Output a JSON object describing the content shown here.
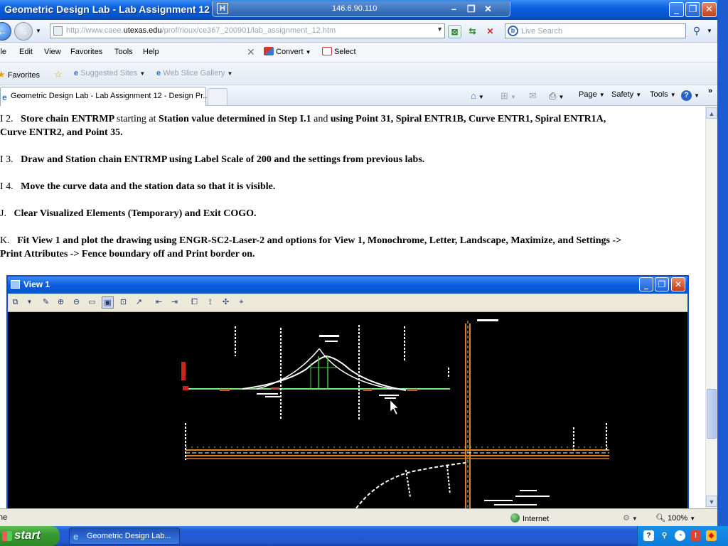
{
  "window": {
    "title": "Geometric Design Lab - Lab Assignment 12 - ",
    "remote_host": "146.6.90.110",
    "colors": {
      "xp_blue": "#0a5fdf",
      "close_red": "#c33f17",
      "cad_bg": "#000000"
    }
  },
  "address_bar": {
    "url_prefix": "http://www.caee.",
    "url_domain": "utexas.edu",
    "url_path": "/prof/rioux/ce367_200901/lab_assignment_12.htm",
    "search_placeholder": "Live Search"
  },
  "menu": {
    "items": [
      "ile",
      "Edit",
      "View",
      "Favorites",
      "Tools",
      "Help"
    ],
    "convert_label": "Convert",
    "select_label": "Select"
  },
  "favorites_bar": {
    "favorites_label": "Favorites",
    "suggested_sites": "Suggested Sites",
    "web_slice_gallery": "Web Slice Gallery"
  },
  "tabs": {
    "active_tab": "Geometric Design Lab - Lab Assignment 12 - Design Pr...",
    "commands": [
      "Page",
      "Safety",
      "Tools"
    ]
  },
  "content": {
    "p1": {
      "num": "I 2.",
      "a": "Store chain ENTRMP ",
      "b": "starting at",
      "c": " Station value determined in Step I.1 ",
      "d": "and",
      "e": " using Point 31, Spiral ENTR1B, Curve ENTR1, Spiral ENTR1A,",
      "line2": "Curve ENTR2, and Point 35."
    },
    "p2": {
      "num": "I 3.",
      "text": "Draw and Station chain ENTRMP using Label Scale of 200 and the settings from previous labs."
    },
    "p3": {
      "num": "I 4.",
      "text": "Move the curve data and the station data so that it is visible."
    },
    "p4": {
      "num": "J.",
      "text": "Clear Visualized Elements (Temporary) and Exit COGO."
    },
    "p5": {
      "num": "K.",
      "line1": "Fit View 1 and plot the drawing using ENGR-SC2-Laser-2 and options for View 1, Monochrome, Letter, Landscape, Maximize, and Settings ->",
      "line2": "Print Attributes -> Fence boundary off and Print border on."
    }
  },
  "cad_window": {
    "title": "View 1"
  },
  "status_bar": {
    "left_text": "ne",
    "zone": "Internet",
    "zoom": "100%"
  },
  "taskbar": {
    "start_label": "start",
    "task_label": "Geometric Design Lab..."
  }
}
